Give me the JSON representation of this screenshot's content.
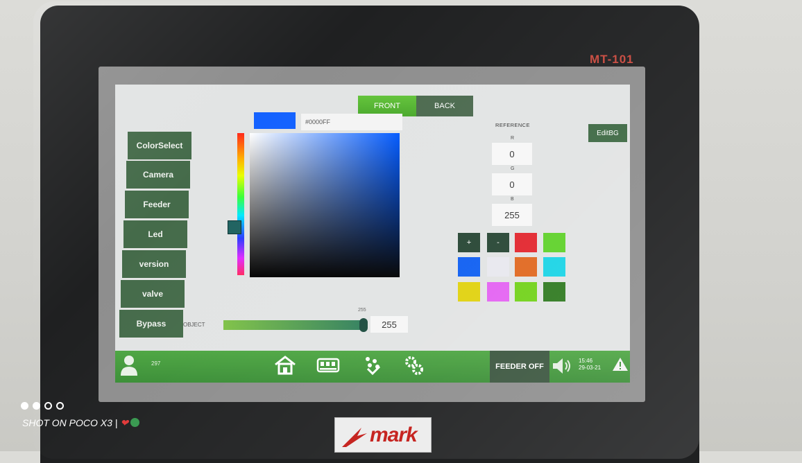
{
  "device": {
    "model": "MT-101",
    "brand": "mark"
  },
  "tabs": [
    {
      "label": "FRONT",
      "active": true
    },
    {
      "label": "BACK",
      "active": false
    }
  ],
  "sidebar": {
    "items": [
      {
        "label": "ColorSelect"
      },
      {
        "label": "Camera"
      },
      {
        "label": "Feeder"
      },
      {
        "label": "Led"
      },
      {
        "label": "version"
      },
      {
        "label": "valve"
      },
      {
        "label": "Bypass"
      }
    ]
  },
  "color_picker": {
    "hex_value": "#0000FF",
    "selected_color": "#1462ff"
  },
  "reference": {
    "title": "REFERENCE",
    "r_label": "R",
    "r_value": "0",
    "g_label": "G",
    "g_value": "0",
    "b_label": "B",
    "b_value": "255"
  },
  "edit_bg_label": "EditBG",
  "palette": {
    "plus_label": "+",
    "minus_label": "-",
    "colors": [
      "#e2262e",
      "#5fd12a",
      "#0f5ff2",
      "#e8e8ee",
      "#e06820",
      "#1ad4e6",
      "#e0d20f",
      "#e463f2",
      "#72d21a",
      "#2f7a20"
    ]
  },
  "slider": {
    "label": "OBJECT",
    "top_value": "255",
    "value": "255",
    "level_fraction": 1.0
  },
  "status_bar": {
    "user_id": "297",
    "feeder_label": "FEEDER OFF",
    "time": "15:46",
    "date": "29-03-21"
  },
  "icons": {
    "user": "user-icon",
    "home": "home-icon",
    "machine": "machine-icon",
    "drops": "drops-icon",
    "settings": "gears-icon",
    "speaker": "speaker-icon",
    "warning": "warning-icon"
  },
  "camera_overlay": {
    "watermark": "SHOT ON POCO X3 |"
  }
}
